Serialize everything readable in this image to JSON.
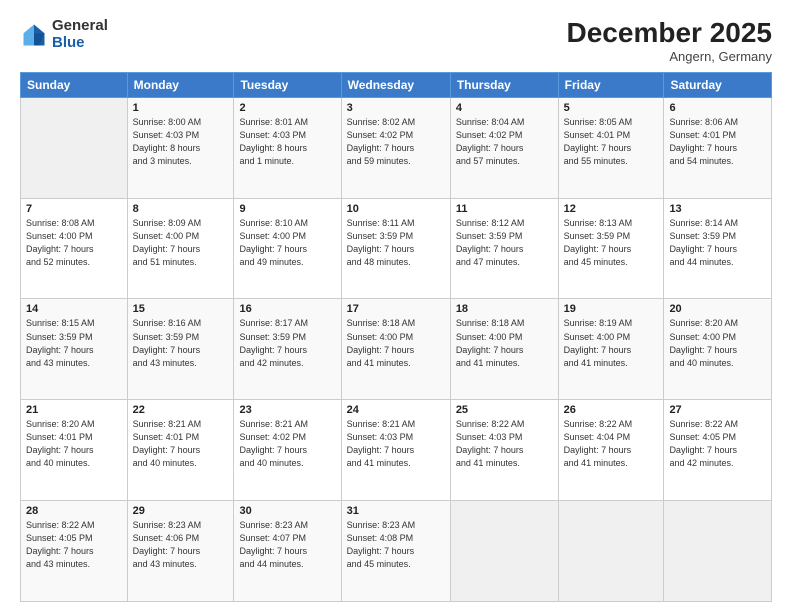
{
  "logo": {
    "general": "General",
    "blue": "Blue"
  },
  "header": {
    "month": "December 2025",
    "location": "Angern, Germany"
  },
  "weekdays": [
    "Sunday",
    "Monday",
    "Tuesday",
    "Wednesday",
    "Thursday",
    "Friday",
    "Saturday"
  ],
  "weeks": [
    [
      {
        "day": "",
        "info": ""
      },
      {
        "day": "1",
        "info": "Sunrise: 8:00 AM\nSunset: 4:03 PM\nDaylight: 8 hours\nand 3 minutes."
      },
      {
        "day": "2",
        "info": "Sunrise: 8:01 AM\nSunset: 4:03 PM\nDaylight: 8 hours\nand 1 minute."
      },
      {
        "day": "3",
        "info": "Sunrise: 8:02 AM\nSunset: 4:02 PM\nDaylight: 7 hours\nand 59 minutes."
      },
      {
        "day": "4",
        "info": "Sunrise: 8:04 AM\nSunset: 4:02 PM\nDaylight: 7 hours\nand 57 minutes."
      },
      {
        "day": "5",
        "info": "Sunrise: 8:05 AM\nSunset: 4:01 PM\nDaylight: 7 hours\nand 55 minutes."
      },
      {
        "day": "6",
        "info": "Sunrise: 8:06 AM\nSunset: 4:01 PM\nDaylight: 7 hours\nand 54 minutes."
      }
    ],
    [
      {
        "day": "7",
        "info": "Sunrise: 8:08 AM\nSunset: 4:00 PM\nDaylight: 7 hours\nand 52 minutes."
      },
      {
        "day": "8",
        "info": "Sunrise: 8:09 AM\nSunset: 4:00 PM\nDaylight: 7 hours\nand 51 minutes."
      },
      {
        "day": "9",
        "info": "Sunrise: 8:10 AM\nSunset: 4:00 PM\nDaylight: 7 hours\nand 49 minutes."
      },
      {
        "day": "10",
        "info": "Sunrise: 8:11 AM\nSunset: 3:59 PM\nDaylight: 7 hours\nand 48 minutes."
      },
      {
        "day": "11",
        "info": "Sunrise: 8:12 AM\nSunset: 3:59 PM\nDaylight: 7 hours\nand 47 minutes."
      },
      {
        "day": "12",
        "info": "Sunrise: 8:13 AM\nSunset: 3:59 PM\nDaylight: 7 hours\nand 45 minutes."
      },
      {
        "day": "13",
        "info": "Sunrise: 8:14 AM\nSunset: 3:59 PM\nDaylight: 7 hours\nand 44 minutes."
      }
    ],
    [
      {
        "day": "14",
        "info": "Sunrise: 8:15 AM\nSunset: 3:59 PM\nDaylight: 7 hours\nand 43 minutes."
      },
      {
        "day": "15",
        "info": "Sunrise: 8:16 AM\nSunset: 3:59 PM\nDaylight: 7 hours\nand 43 minutes."
      },
      {
        "day": "16",
        "info": "Sunrise: 8:17 AM\nSunset: 3:59 PM\nDaylight: 7 hours\nand 42 minutes."
      },
      {
        "day": "17",
        "info": "Sunrise: 8:18 AM\nSunset: 4:00 PM\nDaylight: 7 hours\nand 41 minutes."
      },
      {
        "day": "18",
        "info": "Sunrise: 8:18 AM\nSunset: 4:00 PM\nDaylight: 7 hours\nand 41 minutes."
      },
      {
        "day": "19",
        "info": "Sunrise: 8:19 AM\nSunset: 4:00 PM\nDaylight: 7 hours\nand 41 minutes."
      },
      {
        "day": "20",
        "info": "Sunrise: 8:20 AM\nSunset: 4:00 PM\nDaylight: 7 hours\nand 40 minutes."
      }
    ],
    [
      {
        "day": "21",
        "info": "Sunrise: 8:20 AM\nSunset: 4:01 PM\nDaylight: 7 hours\nand 40 minutes."
      },
      {
        "day": "22",
        "info": "Sunrise: 8:21 AM\nSunset: 4:01 PM\nDaylight: 7 hours\nand 40 minutes."
      },
      {
        "day": "23",
        "info": "Sunrise: 8:21 AM\nSunset: 4:02 PM\nDaylight: 7 hours\nand 40 minutes."
      },
      {
        "day": "24",
        "info": "Sunrise: 8:21 AM\nSunset: 4:03 PM\nDaylight: 7 hours\nand 41 minutes."
      },
      {
        "day": "25",
        "info": "Sunrise: 8:22 AM\nSunset: 4:03 PM\nDaylight: 7 hours\nand 41 minutes."
      },
      {
        "day": "26",
        "info": "Sunrise: 8:22 AM\nSunset: 4:04 PM\nDaylight: 7 hours\nand 41 minutes."
      },
      {
        "day": "27",
        "info": "Sunrise: 8:22 AM\nSunset: 4:05 PM\nDaylight: 7 hours\nand 42 minutes."
      }
    ],
    [
      {
        "day": "28",
        "info": "Sunrise: 8:22 AM\nSunset: 4:05 PM\nDaylight: 7 hours\nand 43 minutes."
      },
      {
        "day": "29",
        "info": "Sunrise: 8:23 AM\nSunset: 4:06 PM\nDaylight: 7 hours\nand 43 minutes."
      },
      {
        "day": "30",
        "info": "Sunrise: 8:23 AM\nSunset: 4:07 PM\nDaylight: 7 hours\nand 44 minutes."
      },
      {
        "day": "31",
        "info": "Sunrise: 8:23 AM\nSunset: 4:08 PM\nDaylight: 7 hours\nand 45 minutes."
      },
      {
        "day": "",
        "info": ""
      },
      {
        "day": "",
        "info": ""
      },
      {
        "day": "",
        "info": ""
      }
    ]
  ]
}
